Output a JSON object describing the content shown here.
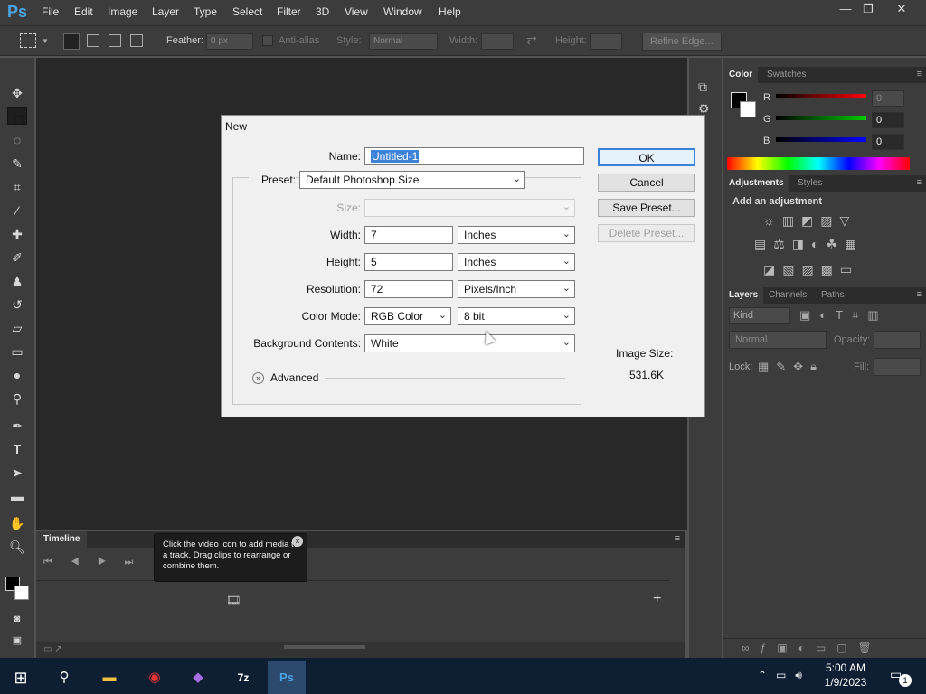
{
  "app": {
    "logo": "Ps"
  },
  "menubar": {
    "items": [
      "File",
      "Edit",
      "Image",
      "Layer",
      "Type",
      "Select",
      "Filter",
      "3D",
      "View",
      "Window",
      "Help"
    ]
  },
  "window_controls": {
    "minimize": "—",
    "restore": "❐",
    "close": "✕"
  },
  "options_bar": {
    "feather_label": "Feather:",
    "feather_value": "0 px",
    "antialias_label": "Anti-alias",
    "style_label": "Style:",
    "style_value": "Normal",
    "width_label": "Width:",
    "height_label": "Height:",
    "refine_label": "Refine Edge..."
  },
  "color_panel": {
    "tabs": [
      "Color",
      "Swatches"
    ],
    "r_label": "R",
    "g_label": "G",
    "b_label": "B",
    "r_value": "0",
    "g_value": "0",
    "b_value": "0"
  },
  "adjustments_panel": {
    "tabs": [
      "Adjustments",
      "Styles"
    ],
    "heading": "Add an adjustment"
  },
  "layers_panel": {
    "tabs": [
      "Layers",
      "Channels",
      "Paths"
    ],
    "kind_label": "Kind",
    "blend_mode": "Normal",
    "opacity_label": "Opacity:",
    "lock_label": "Lock:",
    "fill_label": "Fill:"
  },
  "timeline": {
    "tab": "Timeline",
    "tooltip": "Click the video icon to add media to a track. Drag clips to rearrange or combine them."
  },
  "dialog": {
    "title": "New",
    "name_label": "Name:",
    "name_value": "Untitled-1",
    "preset_label": "Preset:",
    "preset_value": "Default Photoshop Size",
    "size_label": "Size:",
    "width_label": "Width:",
    "width_value": "7",
    "width_unit": "Inches",
    "height_label": "Height:",
    "height_value": "5",
    "height_unit": "Inches",
    "resolution_label": "Resolution:",
    "resolution_value": "72",
    "resolution_unit": "Pixels/Inch",
    "colormode_label": "Color Mode:",
    "colormode_value": "RGB Color",
    "bitdepth_value": "8 bit",
    "bg_label": "Background Contents:",
    "bg_value": "White",
    "advanced_label": "Advanced",
    "ok_label": "OK",
    "cancel_label": "Cancel",
    "save_preset_label": "Save Preset...",
    "delete_preset_label": "Delete Preset...",
    "image_size_label": "Image Size:",
    "image_size_value": "531.6K"
  },
  "taskbar": {
    "time": "5:00 AM",
    "date": "1/9/2023",
    "notification_count": "1"
  },
  "colors": {
    "ps_blue": "#4aa3e0",
    "dialog_bg": "#f0f0f0",
    "selection": "#3c82d8",
    "panel": "#3c3c3c",
    "canvas": "#282828"
  }
}
